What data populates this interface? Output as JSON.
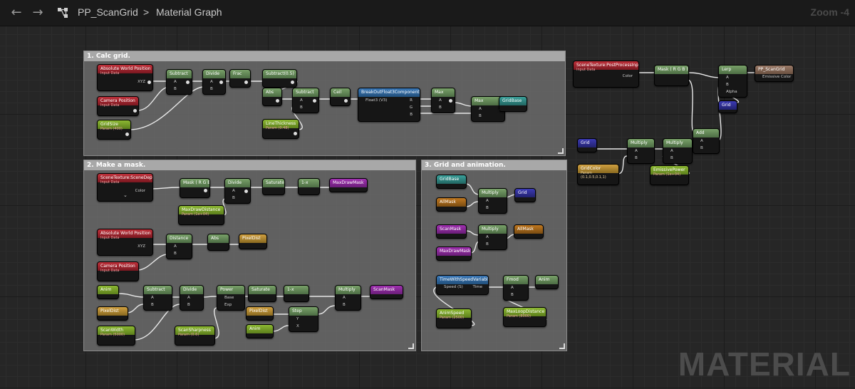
{
  "header": {
    "back_icon": "arrow-left-icon",
    "forward_icon": "arrow-right-icon",
    "asset_name": "PP_ScanGrid",
    "separator": ">",
    "graph_name": "Material Graph",
    "zoom": "Zoom -4"
  },
  "comments": {
    "calc": "1. Calc grid.",
    "mask": "2. Make a mask.",
    "anim": "3. Grid and animation."
  },
  "nodes": {
    "abs_world_pos_1": {
      "title": "Absolute World Position",
      "sub": "Input Data",
      "out": "XYZ"
    },
    "camera_pos_1": {
      "title": "Camera Position",
      "sub": "Input Data"
    },
    "gridsize_1": {
      "title": "GridSize",
      "sub": "Param (400)"
    },
    "subtract_1": {
      "title": "Subtract"
    },
    "divide_1": {
      "title": "Divide"
    },
    "frac_1": {
      "title": "Frac"
    },
    "subtract_05": {
      "title": "Subtract(0.5)"
    },
    "abs_1": {
      "title": "Abs"
    },
    "subtract_2": {
      "title": "Subtract"
    },
    "ceil_1": {
      "title": "Ceil"
    },
    "linethickness": {
      "title": "LineThickness",
      "sub": "Param (0.48)"
    },
    "breakout": {
      "title": "BreakOutFloat3Components",
      "in": "Float3 (V3)",
      "outs": [
        "R",
        "G",
        "B"
      ]
    },
    "max_1": {
      "title": "Max"
    },
    "max_2": {
      "title": "Max"
    },
    "gridbase_1": {
      "title": "GridBase"
    },
    "scenetex_depth": {
      "title": "SceneTexture:SceneDepth",
      "sub": "Input Data",
      "out": "Color"
    },
    "mask_rgb_1": {
      "title": "Mask ( R G B )"
    },
    "divide_2": {
      "title": "Divide"
    },
    "saturate_1": {
      "title": "Saturate"
    },
    "oneminus_1": {
      "title": "1-x"
    },
    "maxdrawmask_1": {
      "title": "MaxDrawMask"
    },
    "maxdrawdistance": {
      "title": "MaxDrawDistance",
      "sub": "Param (1e+04)"
    },
    "abs_world_pos_2": {
      "title": "Absolute World Position",
      "sub": "Input Data",
      "out": "XYZ"
    },
    "distance_1": {
      "title": "Distance"
    },
    "abs_2": {
      "title": "Abs"
    },
    "pixeldist_1": {
      "title": "PixelDist"
    },
    "camera_pos_2": {
      "title": "Camera Position",
      "sub": "Input Data"
    },
    "anim_1": {
      "title": "Anim"
    },
    "subtract_3": {
      "title": "Subtract"
    },
    "divide_3": {
      "title": "Divide"
    },
    "power_1": {
      "title": "Power",
      "pins": [
        "Base",
        "Exp"
      ]
    },
    "saturate_2": {
      "title": "Saturate"
    },
    "oneminus_2": {
      "title": "1-x"
    },
    "multiply_1": {
      "title": "Multiply"
    },
    "scanmask_1": {
      "title": "ScanMask"
    },
    "pixeldist_2": {
      "title": "PixelDist"
    },
    "pixeldist_3": {
      "title": "PixelDist"
    },
    "step_1": {
      "title": "Step",
      "pins": [
        "Y",
        "X"
      ]
    },
    "anim_2": {
      "title": "Anim"
    },
    "scanwidth": {
      "title": "ScanWidth",
      "sub": "Param (5000)"
    },
    "scansharpness": {
      "title": "ScanSharpness",
      "sub": "Param (0.6)"
    },
    "gridbase_2": {
      "title": "GridBase"
    },
    "allmask_1": {
      "title": "AllMask"
    },
    "multiply_2": {
      "title": "Multiply"
    },
    "grid_1": {
      "title": "Grid"
    },
    "scanmask_2": {
      "title": "ScanMask"
    },
    "maxdrawmask_2": {
      "title": "MaxDrawMask"
    },
    "multiply_3": {
      "title": "Multiply"
    },
    "allmask_2": {
      "title": "AllMask"
    },
    "time_speed": {
      "title": "TimeWithSpeedVariable",
      "pins": [
        "Speed (S)",
        "Time"
      ]
    },
    "fmod_1": {
      "title": "Fmod"
    },
    "anim_3": {
      "title": "Anim"
    },
    "animspeed": {
      "title": "AnimSpeed",
      "sub": "Param (2500)"
    },
    "maxloopdistance": {
      "title": "MaxLoopDistance",
      "sub": "Param (8000)"
    },
    "scenetex_post": {
      "title": "SceneTexture:PostProcessInput0",
      "sub": "Input Data",
      "out": "Color"
    },
    "mask_rgb_2": {
      "title": "Mask ( R G B )"
    },
    "lerp_1": {
      "title": "Lerp",
      "pins": [
        "A",
        "B",
        "Alpha"
      ]
    },
    "pp_scangrid": {
      "title": "PP_ScanGrid",
      "out": "Emissive Color"
    },
    "grid_2": {
      "title": "Grid"
    },
    "add_1": {
      "title": "Add"
    },
    "grid_3": {
      "title": "Grid"
    },
    "multiply_4": {
      "title": "Multiply"
    },
    "multiply_5": {
      "title": "Multiply"
    },
    "gridcolor": {
      "title": "GridColor",
      "sub": "Param (0.1,0.5,0.1,1)"
    },
    "emissivepower": {
      "title": "EmissivePower",
      "sub": "Param (1e+04)"
    }
  },
  "pin_labels": {
    "a": "A",
    "b": "B"
  },
  "watermark": "MATERIAL",
  "colors": {
    "background": "#262626",
    "comment": "#6e6e6e",
    "input_red": "#c0303a",
    "param_lime": "#8cb832",
    "op_green": "#78a068"
  }
}
